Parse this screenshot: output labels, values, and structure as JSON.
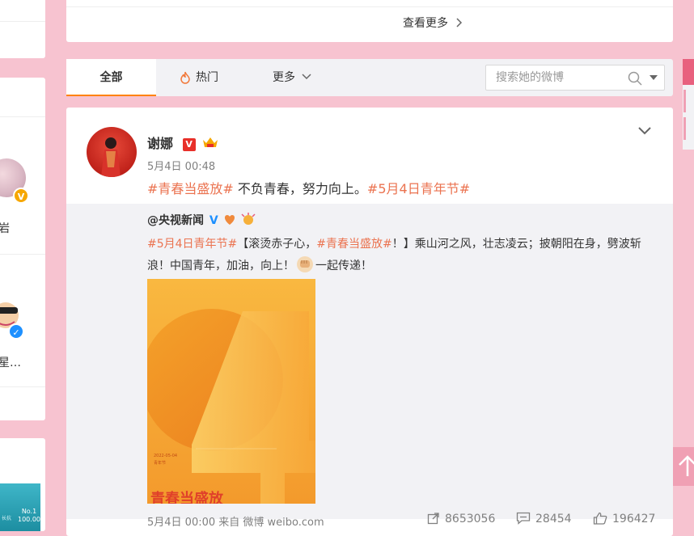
{
  "left_column": {
    "users": [
      {
        "name_fragment": "岩"
      },
      {
        "name_fragment": "星…"
      }
    ],
    "ad_badge": {
      "title": "No.1",
      "value": "100.00",
      "sub": "长抗"
    }
  },
  "top_card": {
    "see_more_label": "查看更多"
  },
  "tabs": {
    "all_label": "全部",
    "hot_label": "热门",
    "more_label": "更多",
    "search_placeholder": "搜索她的微博"
  },
  "post": {
    "author": "谢娜",
    "time": "5月4日 00:48",
    "topic_1": "#青春当盛放#",
    "text_middle": " 不负青春，努力向上。",
    "topic_2": "#5月4日青年节#",
    "repost": {
      "author": "@央视新闻",
      "topic_1": "#5月4日青年节#",
      "text_1": "【滚烫赤子心，",
      "topic_2": "#青春当盛放#",
      "text_2": "！】乘山河之风，壮志凌云；披朝阳在身，劈波斩浪！中国青年，加油，向上！",
      "text_3": "一起传递！",
      "poster": {
        "date": "2022-05-04",
        "caption": "青年节",
        "headline": "青春当盛放"
      }
    },
    "footer_time": "5月4日 00:00 来自 微博 weibo.com",
    "reposts": "8653056",
    "comments": "28454",
    "likes": "196427"
  }
}
